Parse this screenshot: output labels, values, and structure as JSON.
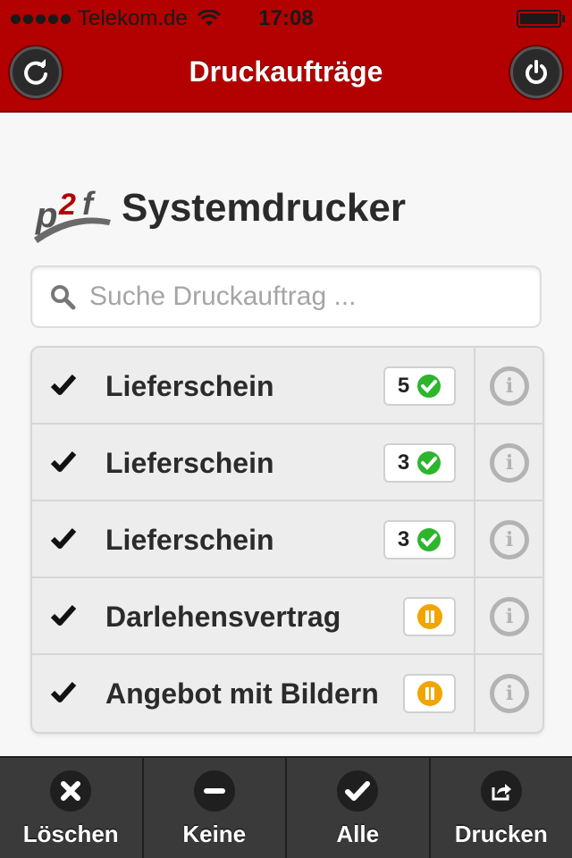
{
  "status_bar": {
    "carrier": "Telekom.de",
    "time": "17:08"
  },
  "nav": {
    "title": "Druckaufträge",
    "left_icon": "refresh-icon",
    "right_icon": "power-icon"
  },
  "header": {
    "logo_text": "p2f",
    "title": "Systemdrucker"
  },
  "search": {
    "placeholder": "Suche Druckauftrag ...",
    "value": ""
  },
  "jobs": [
    {
      "label": "Lieferschein",
      "count": "5",
      "status": "done"
    },
    {
      "label": "Lieferschein",
      "count": "3",
      "status": "done"
    },
    {
      "label": "Lieferschein",
      "count": "3",
      "status": "done"
    },
    {
      "label": "Darlehensvertrag",
      "count": "",
      "status": "paused"
    },
    {
      "label": "Angebot mit Bildern",
      "count": "",
      "status": "paused"
    }
  ],
  "tabbar": {
    "delete": "Löschen",
    "none": "Keine",
    "all": "Alle",
    "print": "Drucken"
  },
  "colors": {
    "brand": "#b30000",
    "ok": "#2db52d",
    "pause": "#f0a500"
  }
}
